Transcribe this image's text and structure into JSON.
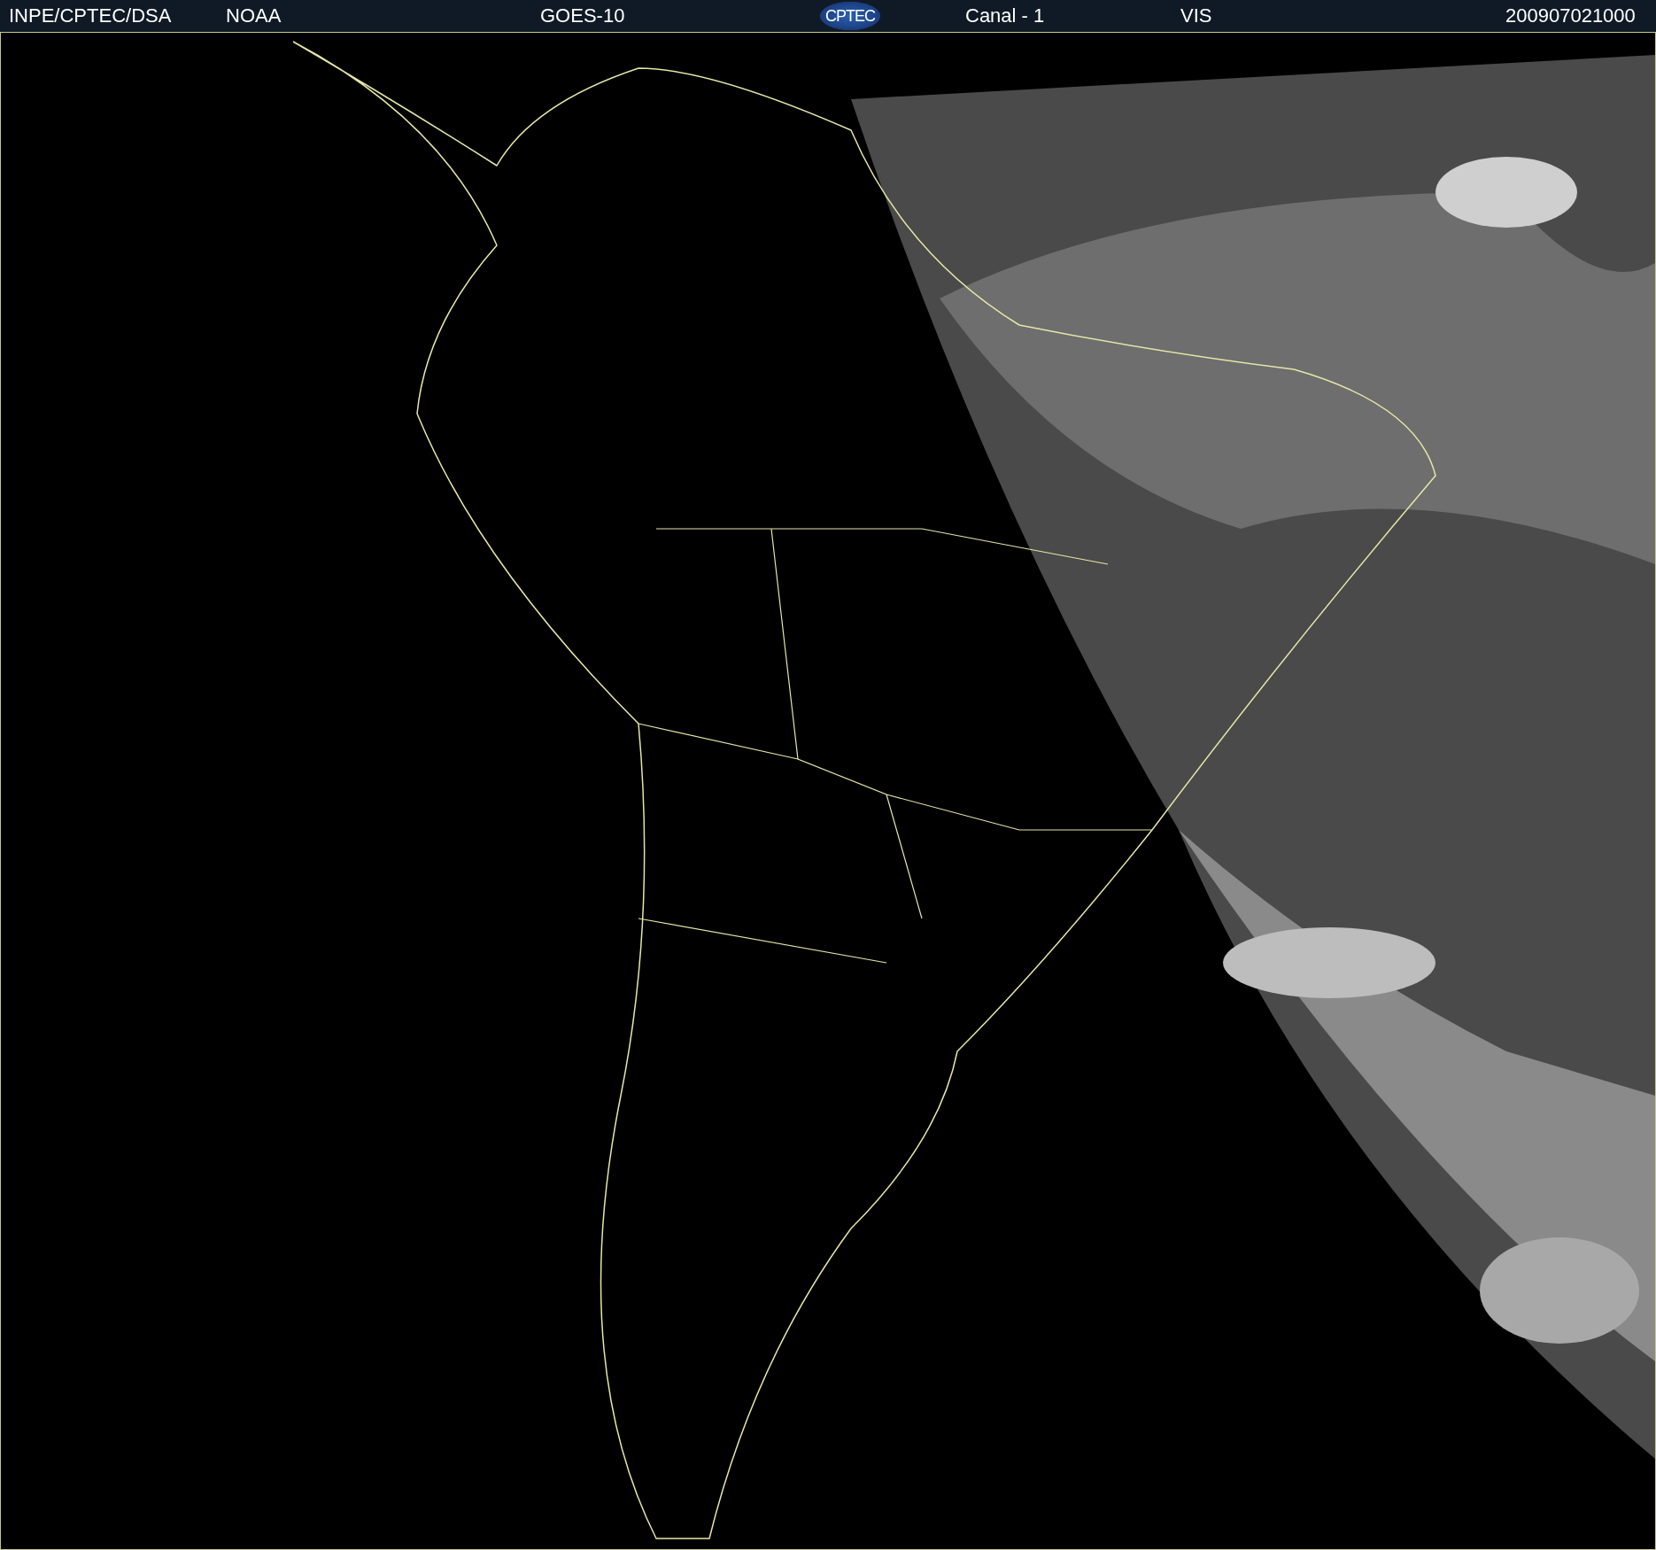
{
  "header": {
    "items": [
      {
        "kind": "text",
        "text": "INPE/CPTEC/DSA"
      },
      {
        "kind": "text",
        "text": "NOAA"
      },
      {
        "kind": "text",
        "text": "GOES-10"
      },
      {
        "kind": "logo",
        "text": "CPTEC"
      },
      {
        "kind": "text",
        "text": "Canal - 1"
      },
      {
        "kind": "text",
        "text": "VIS"
      },
      {
        "kind": "text",
        "text": "200907021000"
      }
    ]
  }
}
